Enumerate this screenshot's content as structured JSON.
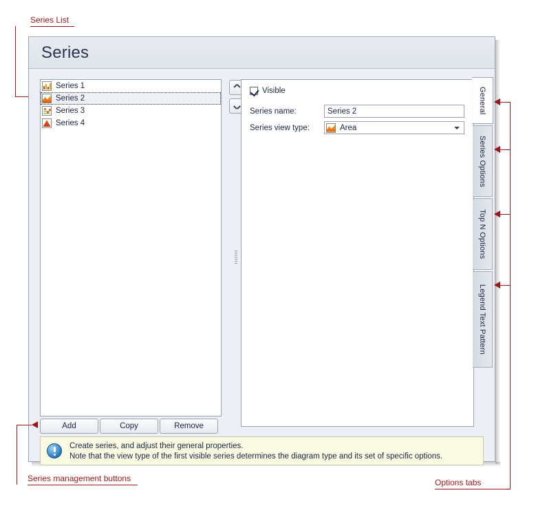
{
  "window": {
    "title": "Series"
  },
  "series_list": {
    "name": "Series List",
    "items": [
      {
        "label": "Series 1",
        "icon": "bar-chart-icon",
        "selected": false
      },
      {
        "label": "Series 2",
        "icon": "area-chart-icon",
        "selected": true
      },
      {
        "label": "Series 3",
        "icon": "point-chart-icon",
        "selected": false
      },
      {
        "label": "Series 4",
        "icon": "radar-chart-icon",
        "selected": false
      }
    ],
    "move_up_icon": "chevron-up-icon",
    "move_down_icon": "chevron-down-icon"
  },
  "general_panel": {
    "visible_checkbox": {
      "label": "Visible",
      "checked": true
    },
    "series_name": {
      "label": "Series name:",
      "value": "Series 2",
      "placeholder": ""
    },
    "series_view_type": {
      "label": "Series view type:",
      "value": "Area",
      "icon": "area-chart-icon"
    }
  },
  "tabs": [
    {
      "label": "General",
      "active": true
    },
    {
      "label": "Series Options",
      "active": false
    },
    {
      "label": "Top N Options",
      "active": false
    },
    {
      "label": "Legend Text Pattern",
      "active": false
    }
  ],
  "buttons": {
    "add": "Add",
    "copy": "Copy",
    "remove": "Remove"
  },
  "info": {
    "icon": "info-icon",
    "line1": "Create series, and adjust their general properties.",
    "line2": "Note that the view type of the first visible series determines the diagram type and its set of specific options."
  },
  "annotations": {
    "series_list": "Series List",
    "series_management_buttons": "Series management buttons",
    "options_tabs": "Options tabs"
  },
  "colors": {
    "annotation": "#9c1616",
    "title_text": "#2a3550",
    "info_background": "#fbfbe4",
    "dialog_background": "#eceff3"
  }
}
